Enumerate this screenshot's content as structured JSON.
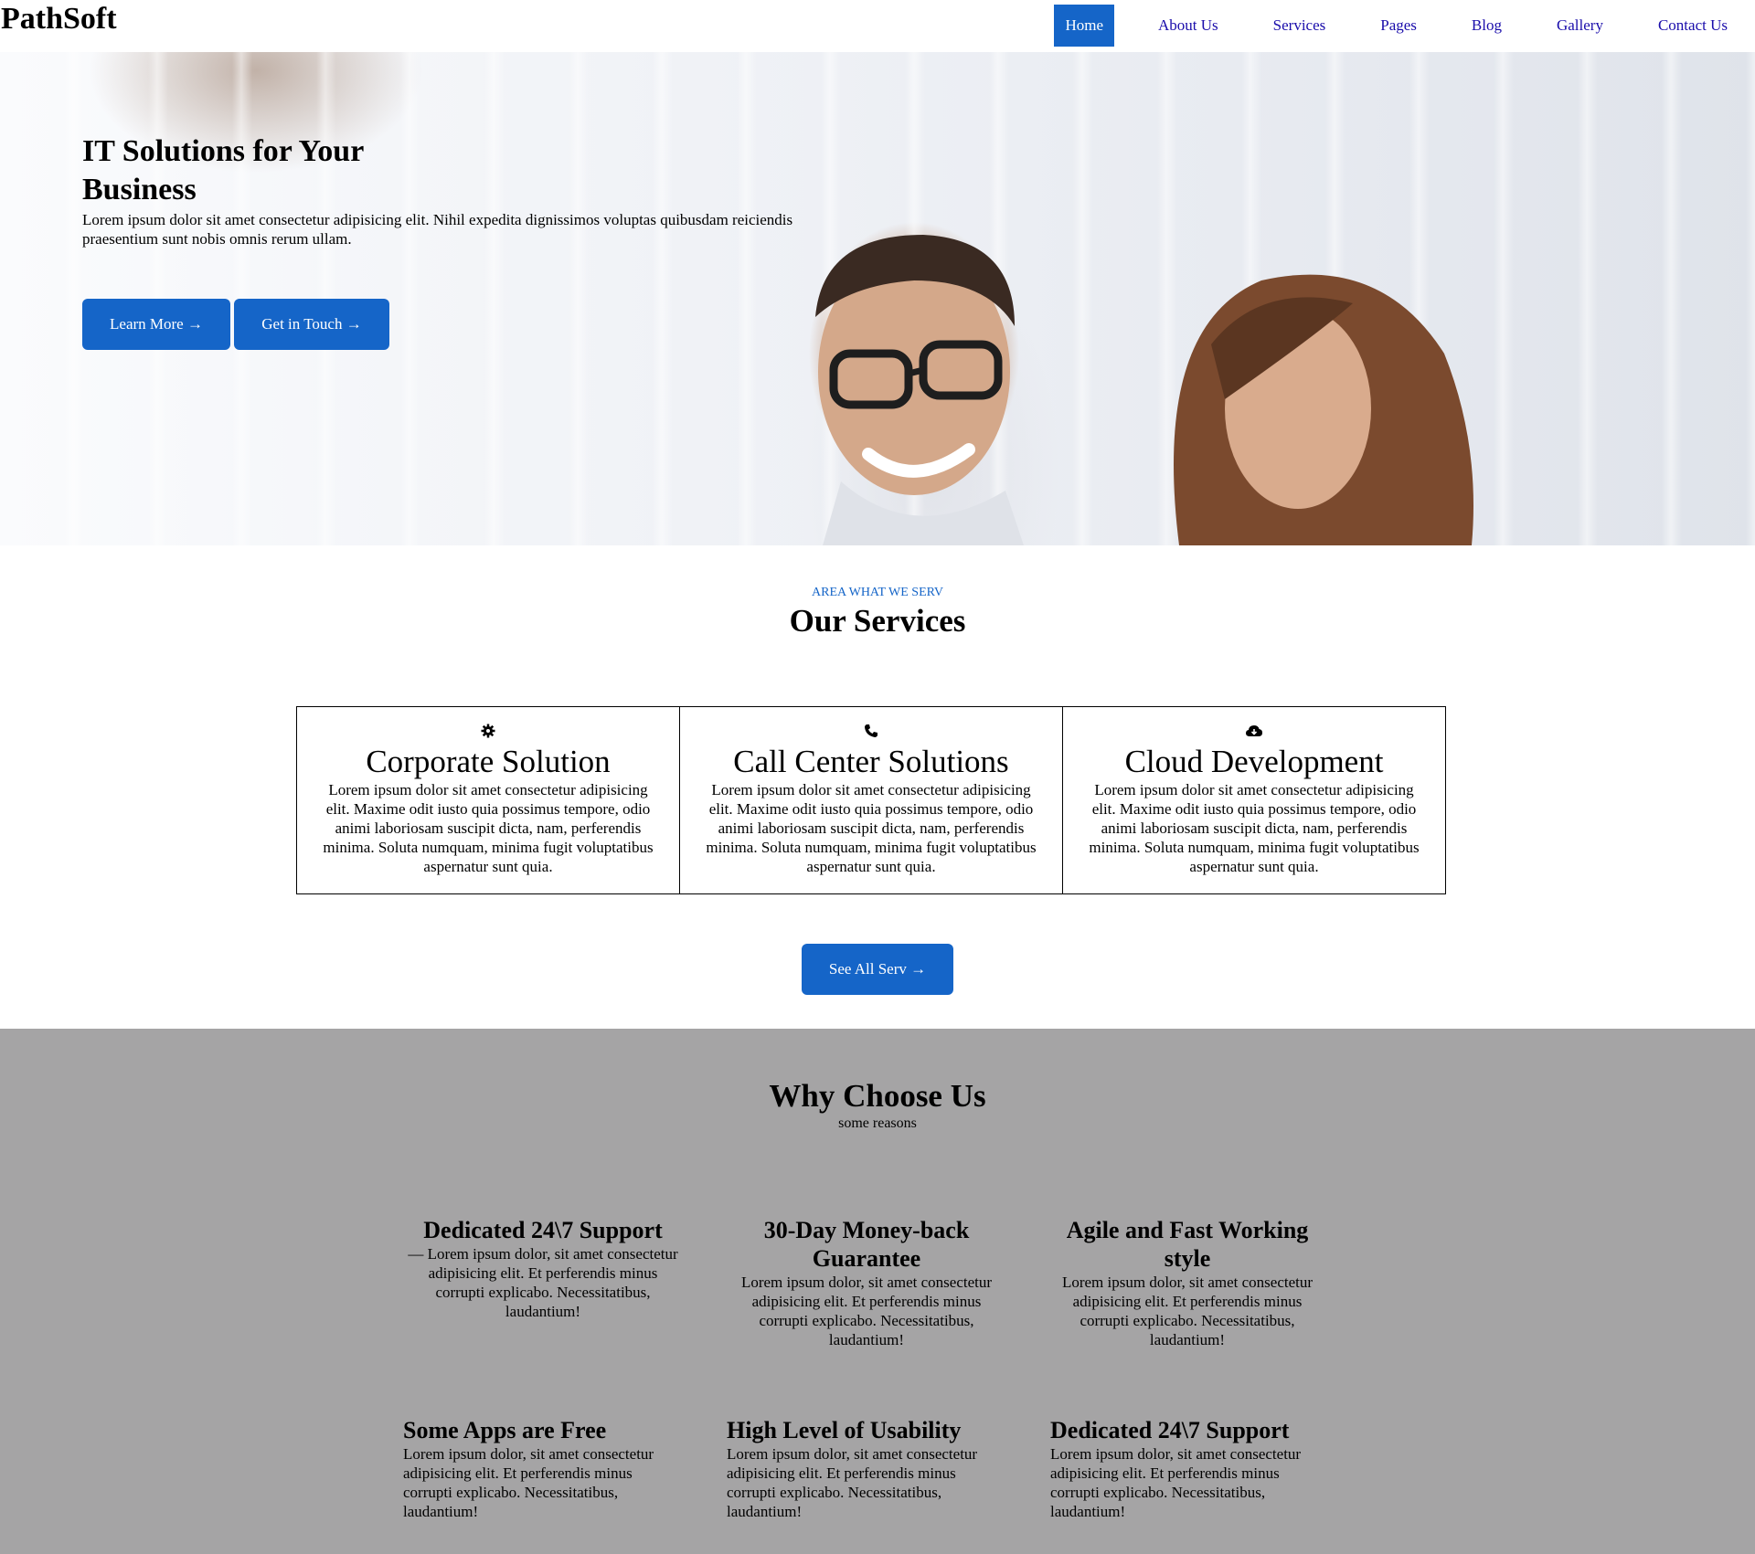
{
  "header": {
    "logo": "PathSoft",
    "nav": [
      "Home",
      "About Us",
      "Services",
      "Pages",
      "Blog",
      "Gallery",
      "Contact Us"
    ],
    "active_nav": "Home"
  },
  "hero": {
    "title": "IT Solutions for Your Business",
    "text": "Lorem ipsum dolor sit amet consectetur adipisicing elit. Nihil expedita dignissimos voluptas quibusdam reiciendis praesentium sunt nobis omnis rerum ullam.",
    "learn_more": "Learn More →",
    "get_in_touch": "Get in Touch →"
  },
  "services": {
    "eyebrow": "AREA WHAT WE SERV",
    "title": "Our Services",
    "cards": [
      {
        "icon": "gear-icon",
        "title": "Corporate Solution",
        "text": "Lorem ipsum dolor sit amet consectetur adipisicing elit. Maxime odit iusto quia possimus tempore, odio animi laboriosam suscipit dicta, nam, perferendis minima. Soluta numquam, minima fugit voluptatibus aspernatur sunt quia."
      },
      {
        "icon": "phone-icon",
        "title": "Call Center Solutions",
        "text": "Lorem ipsum dolor sit amet consectetur adipisicing elit. Maxime odit iusto quia possimus tempore, odio animi laboriosam suscipit dicta, nam, perferendis minima. Soluta numquam, minima fugit voluptatibus aspernatur sunt quia."
      },
      {
        "icon": "cloud-download-icon",
        "title": "Cloud Development",
        "text": "Lorem ipsum dolor sit amet consectetur adipisicing elit. Maxime odit iusto quia possimus tempore, odio animi laboriosam suscipit dicta, nam, perferendis minima. Soluta numquam, minima fugit voluptatibus aspernatur sunt quia."
      }
    ],
    "see_all": "See All Serv →"
  },
  "why": {
    "title": "Why Choose Us",
    "subtitle": "some reasons",
    "features": [
      {
        "title": "Dedicated 24\\7 Support",
        "text": "— Lorem ipsum dolor, sit amet consectetur adipisicing elit. Et perferendis minus corrupti explicabo. Necessitatibus, laudantium!"
      },
      {
        "title": "30-Day Money-back Guarantee",
        "text": "Lorem ipsum dolor, sit amet consectetur adipisicing elit. Et perferendis minus corrupti explicabo. Necessitatibus, laudantium!"
      },
      {
        "title": "Agile and Fast Working style",
        "text": "Lorem ipsum dolor, sit amet consectetur adipisicing elit. Et perferendis minus corrupti explicabo. Necessitatibus, laudantium!"
      },
      {
        "title": "Some Apps are Free",
        "text": "Lorem ipsum dolor, sit amet consectetur adipisicing elit. Et perferendis minus corrupti explicabo. Necessitatibus, laudantium!"
      },
      {
        "title": "High Level of Usability",
        "text": "Lorem ipsum dolor, sit amet consectetur adipisicing elit. Et perferendis minus corrupti explicabo. Necessitatibus, laudantium!"
      },
      {
        "title": "Dedicated 24\\7 Support",
        "text": "Lorem ipsum dolor, sit amet consectetur adipisicing elit. Et perferendis minus corrupti explicabo. Necessitatibus, laudantium!"
      }
    ]
  },
  "colors": {
    "accent": "#1565c8",
    "why_background": "#a5a4a5",
    "nav_link": "#1a0dab"
  }
}
